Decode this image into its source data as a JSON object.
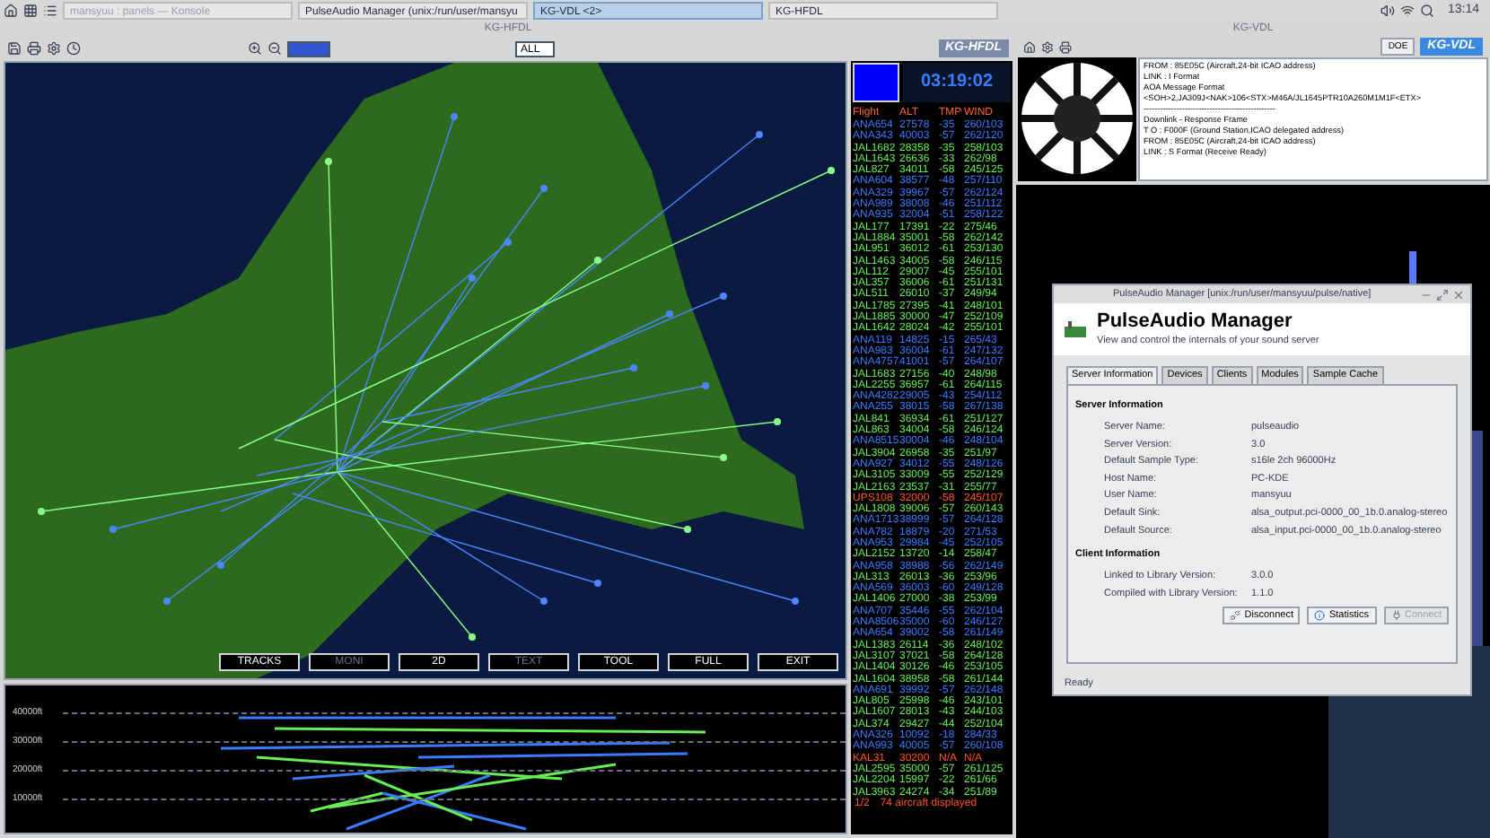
{
  "taskbar": {
    "tasks": [
      {
        "label": "mansyuu : panels — Konsole",
        "selected": false,
        "minimized": true
      },
      {
        "label": "PulseAudio Manager (unix:/run/user/mansyu",
        "selected": false,
        "minimized": false
      },
      {
        "label": "KG-VDL <2>",
        "selected": true,
        "minimized": false
      },
      {
        "label": "KG-HFDL",
        "selected": false,
        "minimized": false
      }
    ],
    "clock": "13:14"
  },
  "hfdl_window": {
    "title": "KG-HFDL",
    "filter": "ALL",
    "logo": "KG-HFDL",
    "map_buttons": [
      {
        "label": "TRACKS",
        "disabled": false
      },
      {
        "label": "MONI",
        "disabled": true
      },
      {
        "label": "2D",
        "disabled": false
      },
      {
        "label": "TEXT",
        "disabled": true
      },
      {
        "label": "TOOL",
        "disabled": false
      },
      {
        "label": "FULL",
        "disabled": false
      },
      {
        "label": "EXIT",
        "disabled": false
      }
    ],
    "profile_axis": [
      "40000ft",
      "30000ft",
      "20000ft",
      "10000ft"
    ],
    "clock": "03:19:02",
    "list_header": [
      "Flight",
      "ALT",
      "TMP",
      "WIND"
    ],
    "flights": [
      {
        "flight": "ANA654",
        "alt": "27578",
        "tmp": "-35",
        "wind": "260/103",
        "color": "#3a7bff"
      },
      {
        "flight": "ANA343",
        "alt": "40003",
        "tmp": "-57",
        "wind": "262/120",
        "color": "#3a7bff"
      },
      {
        "flight": "JAL1682",
        "alt": "28358",
        "tmp": "-35",
        "wind": "258/103",
        "color": "#66ee55"
      },
      {
        "flight": "JAL1643",
        "alt": "26636",
        "tmp": "-33",
        "wind": "262/98",
        "color": "#66ee55"
      },
      {
        "flight": "JAL827",
        "alt": "34011",
        "tmp": "-58",
        "wind": "245/125",
        "color": "#66ee55"
      },
      {
        "flight": "ANA604",
        "alt": "38577",
        "tmp": "-48",
        "wind": "257/110",
        "color": "#3a7bff"
      },
      {
        "flight": "ANA329",
        "alt": "39967",
        "tmp": "-57",
        "wind": "262/124",
        "color": "#3a7bff"
      },
      {
        "flight": "ANA989",
        "alt": "38008",
        "tmp": "-46",
        "wind": "251/112",
        "color": "#3a7bff"
      },
      {
        "flight": "ANA935",
        "alt": "32004",
        "tmp": "-51",
        "wind": "258/122",
        "color": "#3a7bff"
      },
      {
        "flight": "JAL177",
        "alt": "17391",
        "tmp": "-22",
        "wind": "275/46",
        "color": "#66ee55"
      },
      {
        "flight": "JAL1884",
        "alt": "35001",
        "tmp": "-58",
        "wind": "262/142",
        "color": "#66ee55"
      },
      {
        "flight": "JAL951",
        "alt": "36012",
        "tmp": "-61",
        "wind": "253/130",
        "color": "#66ee55"
      },
      {
        "flight": "JAL1463",
        "alt": "34005",
        "tmp": "-58",
        "wind": "246/115",
        "color": "#66ee55"
      },
      {
        "flight": "JAL112",
        "alt": "29007",
        "tmp": "-45",
        "wind": "255/101",
        "color": "#66ee55"
      },
      {
        "flight": "JAL357",
        "alt": "36006",
        "tmp": "-61",
        "wind": "251/131",
        "color": "#66ee55"
      },
      {
        "flight": "JAL511",
        "alt": "26010",
        "tmp": "-37",
        "wind": "249/94",
        "color": "#66ee55"
      },
      {
        "flight": "JAL1785",
        "alt": "27395",
        "tmp": "-41",
        "wind": "248/101",
        "color": "#66ee55"
      },
      {
        "flight": "JAL1885",
        "alt": "30000",
        "tmp": "-47",
        "wind": "252/109",
        "color": "#66ee55"
      },
      {
        "flight": "JAL1642",
        "alt": "28024",
        "tmp": "-42",
        "wind": "255/101",
        "color": "#66ee55"
      },
      {
        "flight": "ANA119",
        "alt": "14825",
        "tmp": "-15",
        "wind": "265/43",
        "color": "#3a7bff"
      },
      {
        "flight": "ANA983",
        "alt": "36004",
        "tmp": "-61",
        "wind": "247/132",
        "color": "#3a7bff"
      },
      {
        "flight": "ANA4757",
        "alt": "41001",
        "tmp": "-57",
        "wind": "264/107",
        "color": "#3a7bff"
      },
      {
        "flight": "JAL1683",
        "alt": "27156",
        "tmp": "-40",
        "wind": "248/98",
        "color": "#66ee55"
      },
      {
        "flight": "JAL2255",
        "alt": "36957",
        "tmp": "-61",
        "wind": "264/115",
        "color": "#66ee55"
      },
      {
        "flight": "ANA4282",
        "alt": "29005",
        "tmp": "-43",
        "wind": "254/112",
        "color": "#3a7bff"
      },
      {
        "flight": "ANA255",
        "alt": "38015",
        "tmp": "-58",
        "wind": "267/138",
        "color": "#3a7bff"
      },
      {
        "flight": "JAL841",
        "alt": "36934",
        "tmp": "-61",
        "wind": "251/127",
        "color": "#66ee55"
      },
      {
        "flight": "JAL863",
        "alt": "34004",
        "tmp": "-58",
        "wind": "246/124",
        "color": "#66ee55"
      },
      {
        "flight": "ANA8515",
        "alt": "30004",
        "tmp": "-46",
        "wind": "248/104",
        "color": "#3a7bff"
      },
      {
        "flight": "JAL3904",
        "alt": "26958",
        "tmp": "-35",
        "wind": "251/97",
        "color": "#66ee55"
      },
      {
        "flight": "ANA927",
        "alt": "34012",
        "tmp": "-55",
        "wind": "248/126",
        "color": "#3a7bff"
      },
      {
        "flight": "JAL3105",
        "alt": "33009",
        "tmp": "-55",
        "wind": "252/129",
        "color": "#66ee55"
      },
      {
        "flight": "JAL2163",
        "alt": "23537",
        "tmp": "-31",
        "wind": "255/77",
        "color": "#66ee55"
      },
      {
        "flight": "UPS108",
        "alt": "32000",
        "tmp": "-58",
        "wind": "245/107",
        "color": "#ff5522"
      },
      {
        "flight": "JAL1808",
        "alt": "39006",
        "tmp": "-57",
        "wind": "260/143",
        "color": "#66ee55"
      },
      {
        "flight": "ANA1713",
        "alt": "38999",
        "tmp": "-57",
        "wind": "264/128",
        "color": "#3a7bff"
      },
      {
        "flight": "ANA782",
        "alt": "18879",
        "tmp": "-20",
        "wind": "271/53",
        "color": "#3a7bff"
      },
      {
        "flight": "ANA953",
        "alt": "29984",
        "tmp": "-45",
        "wind": "252/105",
        "color": "#3a7bff"
      },
      {
        "flight": "JAL2152",
        "alt": "13720",
        "tmp": "-14",
        "wind": "258/47",
        "color": "#66ee55"
      },
      {
        "flight": "ANA958",
        "alt": "38988",
        "tmp": "-56",
        "wind": "262/149",
        "color": "#3a7bff"
      },
      {
        "flight": "JAL313",
        "alt": "26013",
        "tmp": "-36",
        "wind": "253/96",
        "color": "#66ee55"
      },
      {
        "flight": "ANA569",
        "alt": "36003",
        "tmp": "-60",
        "wind": "249/128",
        "color": "#3a7bff"
      },
      {
        "flight": "JAL1406",
        "alt": "27000",
        "tmp": "-38",
        "wind": "253/99",
        "color": "#66ee55"
      },
      {
        "flight": "ANA707",
        "alt": "35446",
        "tmp": "-55",
        "wind": "262/104",
        "color": "#3a7bff"
      },
      {
        "flight": "ANA8506",
        "alt": "35000",
        "tmp": "-60",
        "wind": "246/127",
        "color": "#3a7bff"
      },
      {
        "flight": "ANA654",
        "alt": "39002",
        "tmp": "-58",
        "wind": "261/149",
        "color": "#3a7bff"
      },
      {
        "flight": "JAL1383",
        "alt": "26114",
        "tmp": "-36",
        "wind": "248/102",
        "color": "#66ee55"
      },
      {
        "flight": "JAL3107",
        "alt": "37021",
        "tmp": "-58",
        "wind": "264/128",
        "color": "#66ee55"
      },
      {
        "flight": "JAL1404",
        "alt": "30126",
        "tmp": "-46",
        "wind": "253/105",
        "color": "#66ee55"
      },
      {
        "flight": "JAL1604",
        "alt": "38958",
        "tmp": "-58",
        "wind": "261/144",
        "color": "#66ee55"
      },
      {
        "flight": "ANA691",
        "alt": "39992",
        "tmp": "-57",
        "wind": "262/148",
        "color": "#3a7bff"
      },
      {
        "flight": "JAL805",
        "alt": "25998",
        "tmp": "-46",
        "wind": "243/101",
        "color": "#66ee55"
      },
      {
        "flight": "JAL1607",
        "alt": "28013",
        "tmp": "-43",
        "wind": "244/103",
        "color": "#66ee55"
      },
      {
        "flight": "JAL374",
        "alt": "29427",
        "tmp": "-44",
        "wind": "252/104",
        "color": "#66ee55"
      },
      {
        "flight": "ANA326",
        "alt": "10092",
        "tmp": "-18",
        "wind": "284/33",
        "color": "#3a7bff"
      },
      {
        "flight": "ANA993",
        "alt": "40005",
        "tmp": "-57",
        "wind": "260/108",
        "color": "#3a7bff"
      },
      {
        "flight": "KAL31",
        "alt": "30200",
        "tmp": "N/A",
        "wind": "N/A",
        "color": "#ff5522"
      },
      {
        "flight": "JAL2595",
        "alt": "35000",
        "tmp": "-57",
        "wind": "261/125",
        "color": "#66ee55"
      },
      {
        "flight": "JAL2204",
        "alt": "15997",
        "tmp": "-22",
        "wind": "261/66",
        "color": "#66ee55"
      },
      {
        "flight": "JAL3963",
        "alt": "24274",
        "tmp": "-34",
        "wind": "251/89",
        "color": "#66ee55"
      }
    ],
    "footer_page": "1/2",
    "footer_count": "74 aircraft displayed"
  },
  "vdl_window": {
    "title": "KG-VDL",
    "button": "DOE",
    "logo": "KG-VDL",
    "lines": [
      "FROM : 85E05C (Aircraft,24-bit ICAO address)",
      "LINK : I Format",
      "AOA Message Format",
      "<SOH>2,JA309J<NAK>106<STX>M46A/JL1645PTR10A260M1M1F<ETX>",
      "------------------------------------------------",
      "Downlink - Response Frame",
      "T O : F000F (Ground Station,ICAO delegated address)",
      "FROM : 85E05C (Aircraft,24-bit ICAO address)",
      "LINK : S Format (Receive Ready)"
    ]
  },
  "pulse_window": {
    "title": "PulseAudio Manager [unix:/run/user/mansyuu/pulse/native]",
    "heading": "PulseAudio Manager",
    "subtitle": "View and control the internals of your sound server",
    "tabs": [
      {
        "label": "Server Information",
        "selected": true
      },
      {
        "label": "Devices",
        "selected": false
      },
      {
        "label": "Clients",
        "selected": false
      },
      {
        "label": "Modules",
        "selected": false
      },
      {
        "label": "Sample Cache",
        "selected": false
      }
    ],
    "server_heading": "Server Information",
    "server_fields": [
      {
        "label": "Server Name:",
        "value": "pulseaudio"
      },
      {
        "label": "Server Version:",
        "value": "3.0"
      },
      {
        "label": "Default Sample Type:",
        "value": "s16le 2ch 96000Hz"
      },
      {
        "label": "Host Name:",
        "value": "PC-KDE"
      },
      {
        "label": "User Name:",
        "value": "mansyuu"
      },
      {
        "label": "Default Sink:",
        "value": "alsa_output.pci-0000_00_1b.0.analog-stereo"
      },
      {
        "label": "Default Source:",
        "value": "alsa_input.pci-0000_00_1b.0.analog-stereo"
      }
    ],
    "client_heading": "Client Information",
    "client_fields": [
      {
        "label": "Linked to Library Version:",
        "value": "3.0.0"
      },
      {
        "label": "Compiled with Library Version:",
        "value": "1.1.0"
      }
    ],
    "buttons": [
      {
        "label": "Disconnect",
        "kind": "disconnect",
        "disabled": false
      },
      {
        "label": "Statistics",
        "kind": "info",
        "disabled": false
      },
      {
        "label": "Connect",
        "kind": "connect",
        "disabled": true
      }
    ],
    "status": "Ready"
  }
}
